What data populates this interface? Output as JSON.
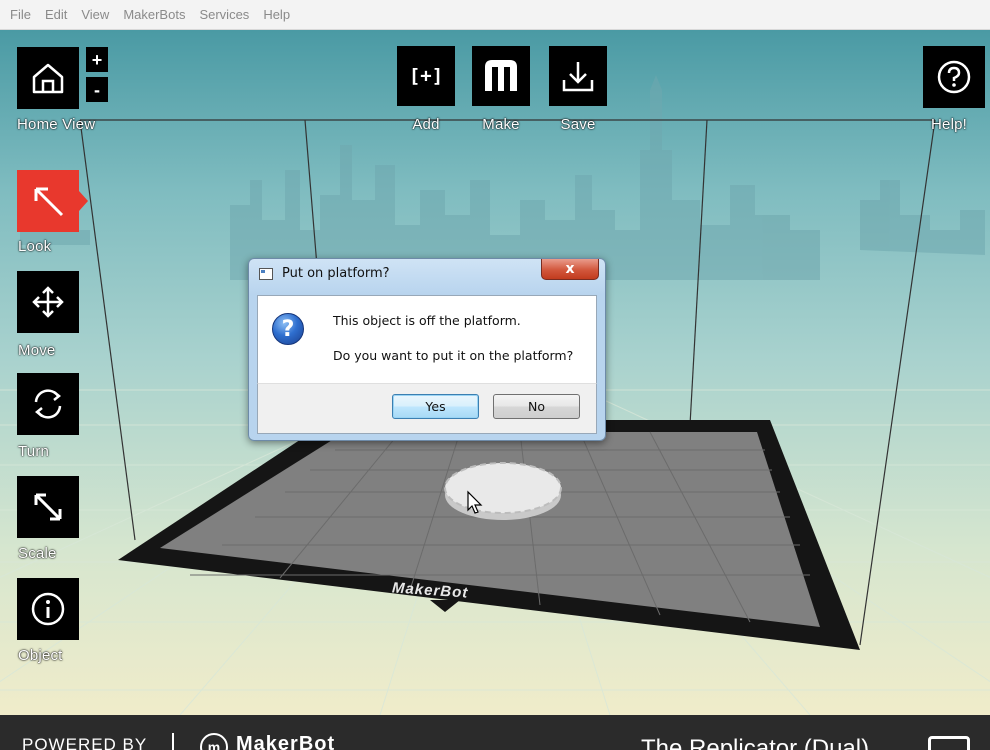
{
  "menu": [
    "File",
    "Edit",
    "View",
    "MakerBots",
    "Services",
    "Help"
  ],
  "toolbar": {
    "home_view_label": "Home View",
    "zoom_in": "+",
    "zoom_out": "-",
    "add_label": "Add",
    "add_glyph": "[+]",
    "make_label": "Make",
    "save_label": "Save",
    "help_label": "Help!"
  },
  "tools": [
    {
      "label": "Look",
      "icon": "look-arrow-icon",
      "active": true
    },
    {
      "label": "Move",
      "icon": "move-arrows-icon",
      "active": false
    },
    {
      "label": "Turn",
      "icon": "rotate-icon",
      "active": false
    },
    {
      "label": "Scale",
      "icon": "scale-arrow-icon",
      "active": false
    },
    {
      "label": "Object",
      "icon": "info-icon",
      "active": false
    }
  ],
  "platform_brand": "MakerBot",
  "dialog": {
    "title": "Put on platform?",
    "close_glyph": "x",
    "message_line1": "This object is off the platform.",
    "message_line2": "Do you want to put it on the platform?",
    "yes_label": "Yes",
    "no_label": "No",
    "icon": "question-icon"
  },
  "footer": {
    "powered_by": "POWERED BY",
    "brand": "MakerBot",
    "printer_name": "The Replicator (Dual)"
  },
  "colors": {
    "active_tool": "#e8382d",
    "tile": "#000000",
    "sky_top": "#4a9aa4",
    "sky_bottom": "#f0ecca",
    "footer_bg": "#2b2b2b"
  }
}
